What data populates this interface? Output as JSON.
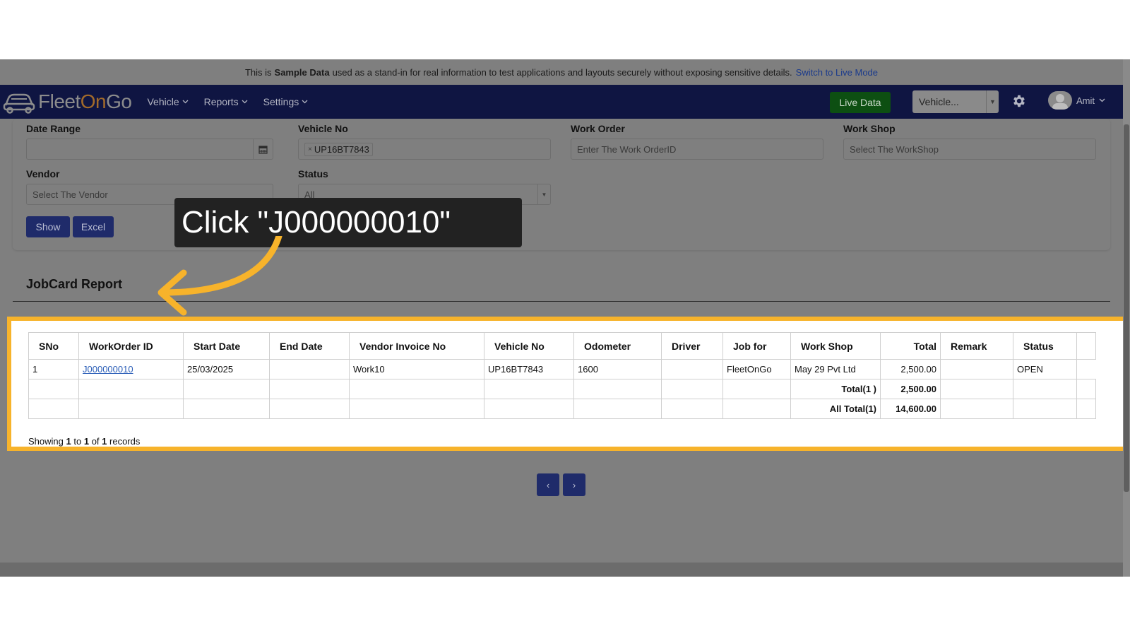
{
  "banner": {
    "prefix": "This is",
    "bold": "Sample Data",
    "rest": "used as a stand-in for real information to test applications and layouts securely without exposing sensitive details.",
    "link": "Switch to Live Mode"
  },
  "navbar": {
    "logo_fleet": "Fleet",
    "logo_on": "On",
    "logo_go": "Go",
    "menu": [
      {
        "label": "Vehicle"
      },
      {
        "label": "Reports"
      },
      {
        "label": "Settings"
      }
    ],
    "live_data": "Live Data",
    "vehicle_select": "Vehicle...",
    "user": "Amit"
  },
  "filters": {
    "date_range_label": "Date Range",
    "date_range_value": "",
    "vehicle_no_label": "Vehicle No",
    "vehicle_chip": "UP16BT7843",
    "work_order_label": "Work Order",
    "work_order_placeholder": "Enter The Work OrderID",
    "workshop_label": "Work Shop",
    "workshop_placeholder": "Select The WorkShop",
    "vendor_label": "Vendor",
    "vendor_placeholder": "Select The Vendor",
    "status_label": "Status",
    "status_value": "All",
    "show_button": "Show",
    "excel_button": "Excel"
  },
  "report": {
    "title": "JobCard Report",
    "columns": [
      "SNo",
      "WorkOrder ID",
      "Start Date",
      "End Date",
      "Vendor Invoice No",
      "Vehicle No",
      "Odometer",
      "Driver",
      "Job for",
      "Work Shop",
      "Total",
      "Remark",
      "Status"
    ],
    "rows": [
      {
        "sno": "1",
        "work_order_id": "J000000010",
        "start_date": "25/03/2025",
        "end_date": "",
        "vendor_invoice_no": "Work10",
        "vehicle_no": "UP16BT7843",
        "odometer": "1600",
        "driver": "",
        "job_for": "FleetOnGo",
        "work_shop": "May 29 Pvt Ltd",
        "total": "2,500.00",
        "remark": "",
        "status": "OPEN"
      }
    ],
    "total_label": "Total(1 )",
    "total_value": "2,500.00",
    "all_total_label": "All Total(1)",
    "all_total_value": "14,600.00",
    "showing_prefix": "Showing",
    "showing_from": "1",
    "showing_to_word": "to",
    "showing_to": "1",
    "showing_of_word": "of",
    "showing_count": "1",
    "showing_suffix": "records"
  },
  "pager": {
    "prev": "‹",
    "next": "›"
  },
  "callout": {
    "text": "Click \"J000000010\""
  },
  "colors": {
    "navbar": "#0f1542",
    "highlight_border": "#f7b32b",
    "button": "#1f2b6a",
    "live_data": "#0d4f12"
  }
}
